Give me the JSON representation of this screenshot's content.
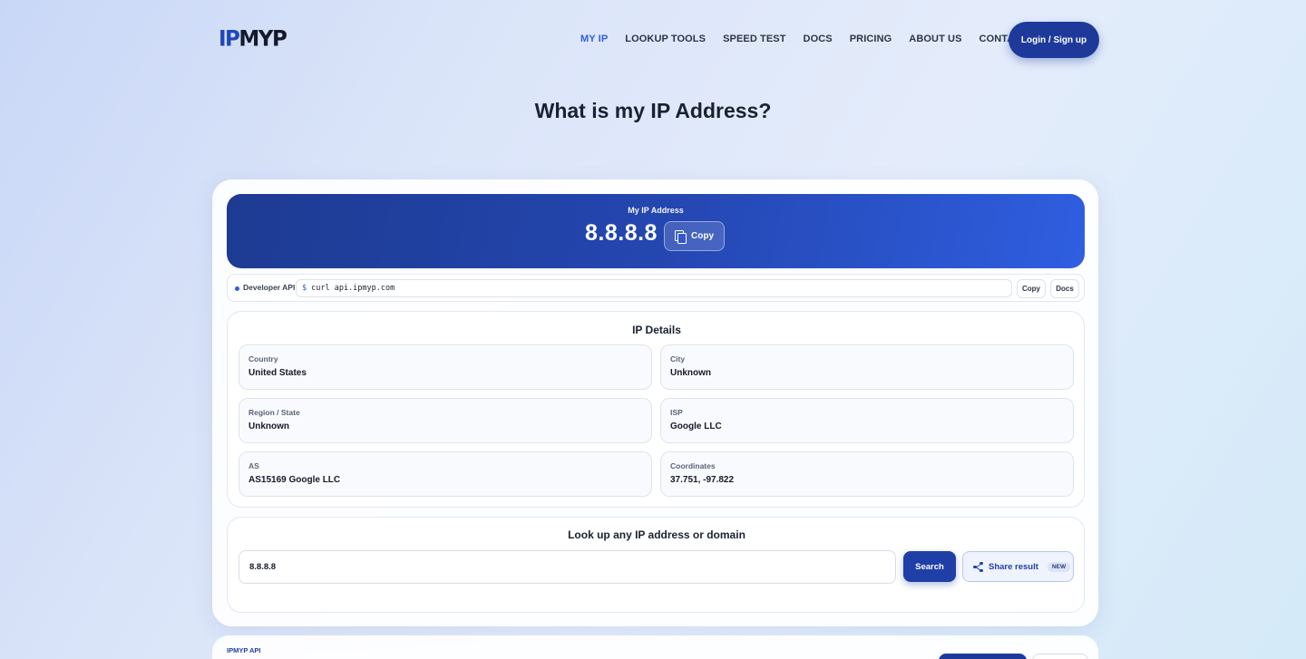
{
  "brand": {
    "logo_ip": "IP",
    "logo_myp": "MYP"
  },
  "nav": {
    "items": [
      {
        "label": "MY IP",
        "active": true
      },
      {
        "label": "LOOKUP TOOLS",
        "active": false
      },
      {
        "label": "SPEED TEST",
        "active": false
      },
      {
        "label": "DOCS",
        "active": false
      },
      {
        "label": "PRICING",
        "active": false
      },
      {
        "label": "ABOUT US",
        "active": false
      },
      {
        "label": "CONTACT US",
        "active": false
      }
    ],
    "login_label": "Login / Sign up"
  },
  "page_title": "What is my IP Address?",
  "hero": {
    "label": "My IP Address",
    "ip": "8.8.8.8",
    "copy_label": "Copy"
  },
  "dev_api": {
    "label": "Developer API:",
    "prompt": "$",
    "command": "curl api.ipmyp.com",
    "copy_label": "Copy",
    "docs_label": "Docs"
  },
  "details": {
    "title": "IP Details",
    "fields": [
      {
        "label": "Country",
        "value": "United States"
      },
      {
        "label": "City",
        "value": "Unknown"
      },
      {
        "label": "Region / State",
        "value": "Unknown"
      },
      {
        "label": "ISP",
        "value": "Google LLC"
      },
      {
        "label": "AS",
        "value": "AS15169 Google LLC"
      },
      {
        "label": "Coordinates",
        "value": "37.751, -97.822"
      }
    ]
  },
  "lookup": {
    "title": "Look up any IP address or domain",
    "input_value": "8.8.8.8",
    "search_label": "Search",
    "share_label": "Share result",
    "new_badge": "NEW"
  },
  "bottom": {
    "label": "IPMYP API"
  },
  "colors": {
    "primary": "#1d3a9b",
    "accent": "#2e5fd6"
  }
}
